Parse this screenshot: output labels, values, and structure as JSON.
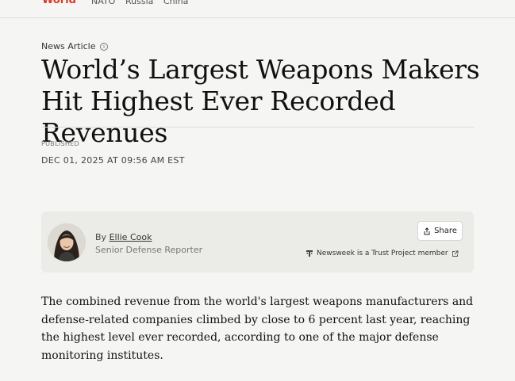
{
  "nav": {
    "section": "World",
    "tags": [
      "NATO",
      "Russia",
      "China"
    ]
  },
  "article": {
    "kicker": "News Article",
    "headline": "World’s Largest Weapons Makers Hit Highest Ever Recorded Revenues",
    "published_label": "PUBLISHED",
    "published_date": "DEC 01, 2025 AT 09:56 AM EST",
    "byline_prefix": "By",
    "author": "Ellie Cook",
    "author_title": "Senior Defense Reporter",
    "share_label": "Share",
    "trust_text": "Newsweek is a Trust Project member",
    "body": "The combined revenue from the world's largest weapons manufacturers and defense-related companies climbed by close to 6 percent last year, reaching the highest level ever recorded, according to one of the major defense monitoring institutes."
  },
  "colors": {
    "section_accent": "#d83a2b",
    "background": "#f5f5f3",
    "card_background": "#ebebe8"
  },
  "icons": {
    "info": "info-icon",
    "share": "share-icon",
    "trust": "trust-project-icon",
    "external": "external-link-icon"
  }
}
